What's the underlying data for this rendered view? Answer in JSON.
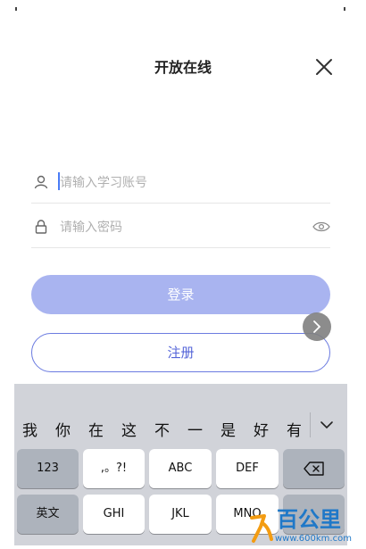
{
  "header": {
    "title": "开放在线"
  },
  "form": {
    "account_placeholder": "请输入学习账号",
    "password_placeholder": "请输入密码"
  },
  "buttons": {
    "login_label": "登录",
    "register_label": "注册"
  },
  "keyboard": {
    "candidates": [
      "我",
      "你",
      "在",
      "这",
      "不",
      "一",
      "是",
      "好",
      "有"
    ],
    "row1": [
      "123",
      ",。?!",
      "ABC",
      "DEF"
    ],
    "row2": [
      "英文",
      "GHI",
      "JKL",
      "MNO"
    ]
  },
  "watermark": {
    "brand": "百公里",
    "url": "www.600km.com"
  },
  "colors": {
    "accent": "#a9b4f0",
    "register_border": "#6b7be0",
    "keyboard_bg": "#d1d3d9"
  }
}
